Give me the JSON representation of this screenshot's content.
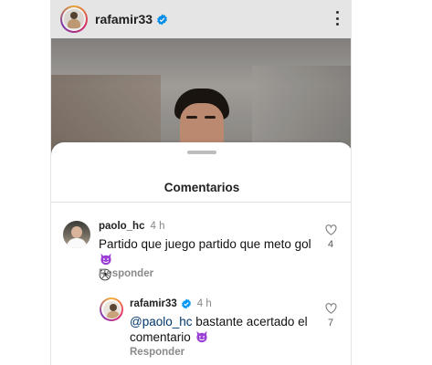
{
  "post": {
    "username": "rafamir33"
  },
  "sheet": {
    "title": "Comentarios"
  },
  "comments": [
    {
      "username": "paolo_hc",
      "time": "4 h",
      "text": "Partido que juego partido que meto gol",
      "emojis": [
        "smiling-devil-emoji",
        "soccer-ball-emoji"
      ],
      "reply_label": "Responder",
      "likes": "4"
    },
    {
      "username": "rafamir33",
      "time": "4 h",
      "mention": "@paolo_hc",
      "text_line1": " bastante acertado el",
      "text_line2": "comentario",
      "emojis": [
        "smiling-devil-emoji"
      ],
      "reply_label": "Responder",
      "likes": "7"
    }
  ],
  "icons": {
    "more": "kebab-menu-icon",
    "verified": "verified-badge-icon",
    "like": "heart-outline-icon"
  },
  "colors": {
    "verified": "#0095f6",
    "mention": "#00376b",
    "devil": "#9b3fd6"
  }
}
